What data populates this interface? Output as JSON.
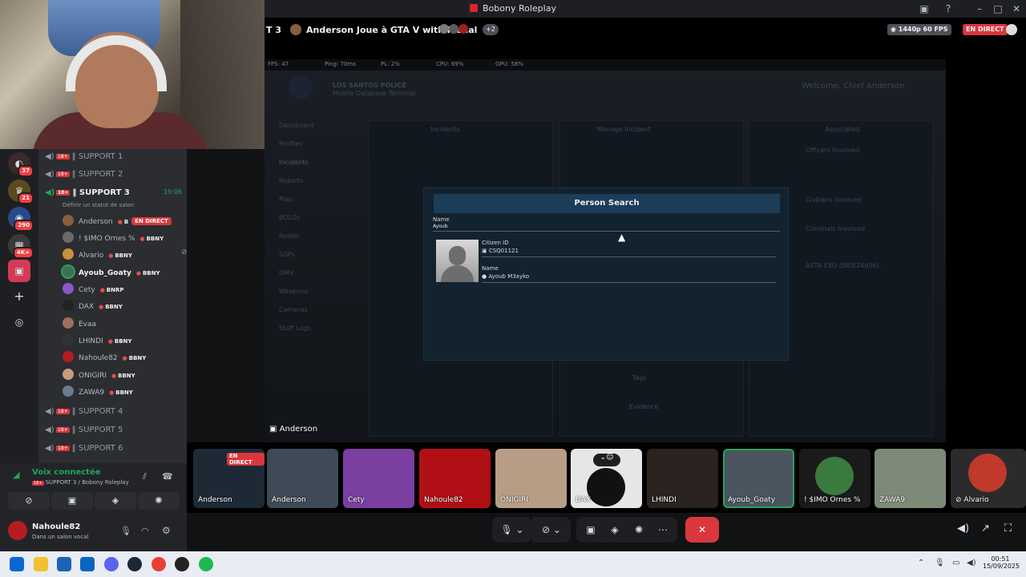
{
  "window": {
    "title": "Bobony Roleplay"
  },
  "stream": {
    "channel_prefix": "T 3",
    "title": "Anderson Joue à GTA V with Medal",
    "extra_count": "+2",
    "quality": "1440p 60 FPS",
    "live_label": "EN DIRECT",
    "stats": {
      "fps": "FPS: 47",
      "ping": "Ping: 70ms",
      "pl": "PL: 2%",
      "cpu": "CPU: 69%",
      "gpu": "GPU: 58%"
    },
    "streamer_label": "Anderson"
  },
  "mdt": {
    "dept": "LOS SANTOS POLICE",
    "subtitle": "Mobile Database Terminal",
    "welcome": "Welcome, Chief Anderson",
    "nav": [
      "Dashboard",
      "Profiles",
      "Incidents",
      "Reports",
      "Map",
      "BOLOs",
      "Roster",
      "SOPs",
      "DMV",
      "Weapons",
      "Cameras",
      "Staff Logs"
    ],
    "columns": {
      "incidents": "Incidents",
      "manage": "Manage Incident",
      "associated": "Associated"
    },
    "sections": {
      "officers": "Officers Involved",
      "civilians": "Civilians Involved",
      "criminals": "Criminals Involved",
      "tags": "Tags",
      "evidence": "Evidence"
    },
    "criminal": "ASTA EXO (BAIE24606)"
  },
  "person_search": {
    "title": "Person Search",
    "name_label": "Name",
    "name_value": "Ayoub",
    "result": {
      "citizen_id_label": "Citizen ID",
      "citizen_id": "CSQ01121",
      "name_label": "Name",
      "name": "Ayoub M3ayko"
    }
  },
  "sidebar": {
    "rail_badges": [
      "37",
      "21",
      "290",
      "4K+"
    ],
    "channels_top": [
      {
        "label": "SUPPORT 1"
      },
      {
        "label": "SUPPORT 2"
      }
    ],
    "active_channel": {
      "label": "SUPPORT 3",
      "time": "19:06",
      "status_hint": "Définir un statut de salon"
    },
    "members": [
      {
        "name": "Anderson",
        "tag": "B",
        "live": "EN DIRECT",
        "color": "#8b5e3c"
      },
      {
        "name": "! $IMO Ornes %",
        "tag": "BBNY",
        "color": "#6a6a6a"
      },
      {
        "name": "Alvario",
        "tag": "BBNY",
        "color": "#c7923e"
      },
      {
        "name": "Ayoub_Goaty",
        "tag": "BBNY",
        "color": "#3f6f55",
        "bold": true
      },
      {
        "name": "Cety",
        "tag": "BNRP",
        "color": "#8e57c9"
      },
      {
        "name": "DAX",
        "tag": "BBNY",
        "color": "#222"
      },
      {
        "name": "Evaa",
        "tag": "",
        "color": "#a06e5c"
      },
      {
        "name": "LHINDI",
        "tag": "BBNY",
        "color": "#333"
      },
      {
        "name": "Nahoule82",
        "tag": "BBNY",
        "color": "#b51d22"
      },
      {
        "name": "ONIGIRI",
        "tag": "BBNY",
        "color": "#c89b7b"
      },
      {
        "name": "ZAWA9",
        "tag": "BBNY",
        "color": "#6b7c8e"
      }
    ],
    "channels_bottom": [
      {
        "label": "SUPPORT 4"
      },
      {
        "label": "SUPPORT 5"
      },
      {
        "label": "SUPPORT 6"
      }
    ]
  },
  "voice": {
    "status": "Voix connectée",
    "channel": "SUPPORT 3 / Bobony Roleplay"
  },
  "user": {
    "name": "Nahoule82",
    "status": "Dans un salon vocal"
  },
  "participants": [
    {
      "name": "Anderson",
      "live": "EN DIRECT",
      "color": "#1d2a36"
    },
    {
      "name": "Anderson",
      "color": "#3e4a56"
    },
    {
      "name": "Cety",
      "color": "#7a3fa0"
    },
    {
      "name": "Nahoule82",
      "color": "#b10f16"
    },
    {
      "name": "ONIGIRI",
      "color": "#b89d86"
    },
    {
      "name": "DAX",
      "color": "#e6e6e6"
    },
    {
      "name": "LHINDI",
      "color": "#2a2320"
    },
    {
      "name": "Ayoub_Goaty",
      "color": "#4a5560"
    },
    {
      "name": "! $IMO Ornes %",
      "color": "#1a1a1a"
    },
    {
      "name": "ZAWA9",
      "color": "#7d8a78"
    },
    {
      "name": "Alvario",
      "color": "#2b2b2b"
    }
  ],
  "taskbar": {
    "time": "00:51",
    "date": "15/09/2025"
  }
}
